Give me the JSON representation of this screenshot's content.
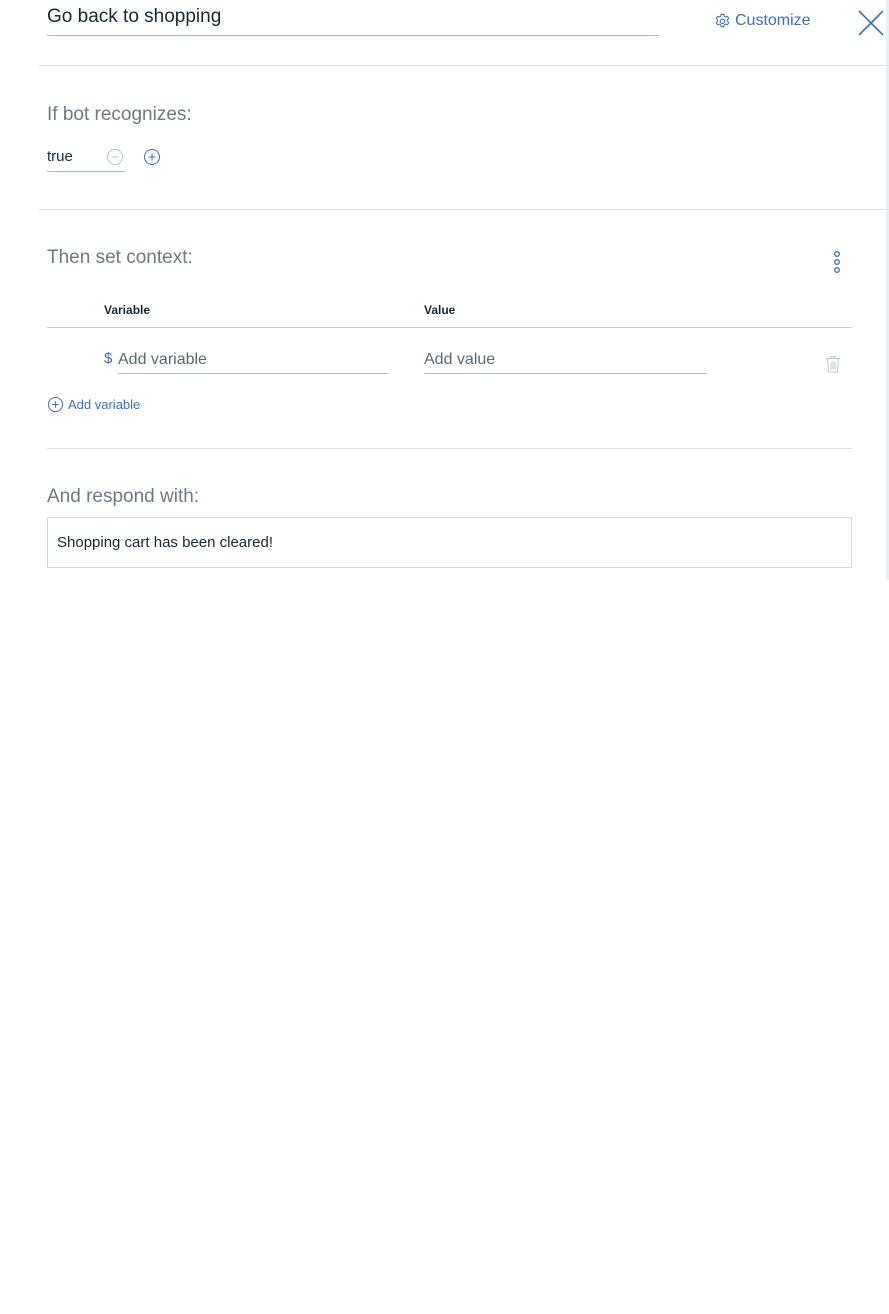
{
  "header": {
    "node_name": "Go back to shopping",
    "customize_label": "Customize"
  },
  "condition": {
    "label": "If bot recognizes:",
    "value": "true"
  },
  "context": {
    "label": "Then set context:",
    "columns": {
      "variable": "Variable",
      "value": "Value"
    },
    "row": {
      "prefix": "$",
      "variable_placeholder": "Add variable",
      "value_placeholder": "Add value"
    },
    "add_variable_label": "Add variable"
  },
  "response": {
    "label": "And respond with:",
    "text": "Shopping cart has been cleared!"
  },
  "colors": {
    "accent": "#3d70b2",
    "text": "#152935",
    "muted": "#6d7a85",
    "divider": "#dfe3e6"
  },
  "icons": [
    "gear-icon",
    "close-icon",
    "minus-circle-icon",
    "plus-circle-icon",
    "overflow-menu-icon",
    "trash-icon"
  ]
}
